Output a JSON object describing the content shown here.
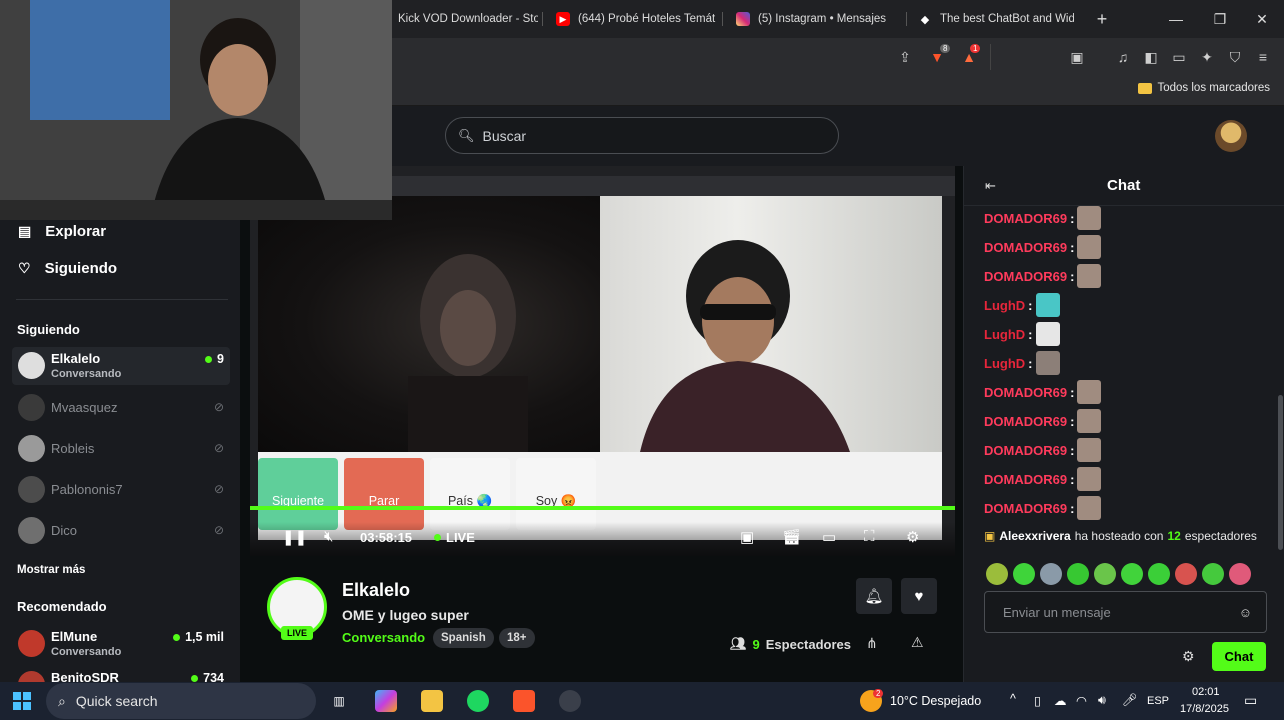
{
  "browser": {
    "tabs": [
      {
        "title": "Kick VOD Downloader - Sto",
        "icon": "kick-icon",
        "color": "#53fc18"
      },
      {
        "title": "(644) Probé Hoteles Temát",
        "icon": "youtube-icon",
        "color": "#ff0000"
      },
      {
        "title": "(5) Instagram • Mensajes",
        "icon": "instagram-icon",
        "color": "#d6249f"
      },
      {
        "title": "The best ChatBot and Wid",
        "icon": "chatbot-icon",
        "color": "#ffffff"
      }
    ],
    "new_tab": "+",
    "minimize": "—",
    "maximize": "❐",
    "close": "✕",
    "bookmark_folder": "Todos los marcadores",
    "shield_badge": "8",
    "rewards_badge": "1"
  },
  "header": {
    "search_placeholder": "Buscar"
  },
  "sidebar": {
    "nav": [
      {
        "label": "Explorar",
        "icon": "explore-icon"
      },
      {
        "label": "Siguiendo",
        "icon": "heart-icon"
      }
    ],
    "following_title": "Siguiendo",
    "following": [
      {
        "name": "Elkalelo",
        "sub": "Conversando",
        "viewers": "9",
        "live": true,
        "color": "#dedede"
      },
      {
        "name": "Mvaasquez",
        "live": false,
        "color": "#3a3a3a"
      },
      {
        "name": "Robleis",
        "live": false,
        "color": "#9a9a9a"
      },
      {
        "name": "Pablononis7",
        "live": false,
        "color": "#4c4c4c"
      },
      {
        "name": "Dico",
        "live": false,
        "color": "#6f6f6f"
      }
    ],
    "show_more": "Mostrar más",
    "recommended_title": "Recomendado",
    "recommended": [
      {
        "name": "ElMune",
        "sub": "Conversando",
        "viewers": "1,5 mil",
        "color": "#c0392b"
      },
      {
        "name": "BenitoSDR",
        "viewers": "734",
        "color": "#b03a2e"
      }
    ]
  },
  "video": {
    "buttons": [
      {
        "label": "Siguiente",
        "bg": "#5fcf9a",
        "color": "#ffffff"
      },
      {
        "label": "Parar",
        "bg": "#e36a54",
        "color": "#ffffff"
      },
      {
        "label": "País 🌏",
        "bg": "#f6f6f6",
        "color": "#333333"
      },
      {
        "label": "Soy 😡",
        "bg": "#f6f6f6",
        "color": "#333333"
      }
    ],
    "time": "03:58:15",
    "live_label": "LIVE"
  },
  "stream": {
    "streamer": "Elkalelo",
    "title": "OME y lugeo super",
    "category": "Conversando",
    "tags": [
      "Spanish",
      "18+"
    ],
    "live_badge": "LIVE",
    "viewers_count": "9",
    "viewers_label": "Espectadores"
  },
  "chat": {
    "title": "Chat",
    "messages": [
      {
        "user": "DOMADOR69",
        "color": "#ff3b5c"
      },
      {
        "user": "DOMADOR69",
        "color": "#ff3b5c"
      },
      {
        "user": "DOMADOR69",
        "color": "#ff3b5c"
      },
      {
        "user": "LughD",
        "color": "#e7263b"
      },
      {
        "user": "LughD",
        "color": "#e7263b"
      },
      {
        "user": "LughD",
        "color": "#e7263b"
      },
      {
        "user": "DOMADOR69",
        "color": "#ff3b5c"
      },
      {
        "user": "DOMADOR69",
        "color": "#ff3b5c"
      },
      {
        "user": "DOMADOR69",
        "color": "#ff3b5c"
      },
      {
        "user": "DOMADOR69",
        "color": "#ff3b5c"
      },
      {
        "user": "DOMADOR69",
        "color": "#ff3b5c"
      }
    ],
    "host": {
      "user": "Aleexxrivera",
      "text": "ha hosteado con",
      "count": "12",
      "suffix": "espectadores"
    },
    "input_placeholder": "Enviar un mensaje",
    "send_label": "Chat"
  },
  "taskbar": {
    "search_label": "Quick search",
    "weather": "10°C  Despejado",
    "weather_badge": "2",
    "lang": "ESP",
    "time": "02:01",
    "date": "17/8/2025"
  },
  "colors": {
    "accent": "#53fc18",
    "background": "#0b0e0f",
    "panel": "#191b1f"
  }
}
